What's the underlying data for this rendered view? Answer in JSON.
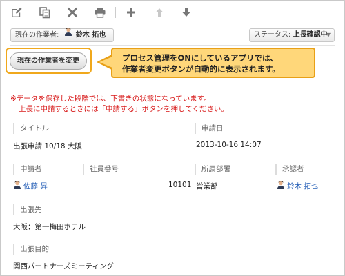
{
  "toolbar": {
    "icons": [
      "edit-icon",
      "copy-icon",
      "delete-icon",
      "print-icon",
      "add-icon",
      "up-arrow-icon",
      "down-arrow-icon"
    ]
  },
  "assignee": {
    "label": "現在の作業者:",
    "name": "鈴木 拓也"
  },
  "status": {
    "label": "ステータス:",
    "value": "上長確認中"
  },
  "change_button": {
    "label": "現在の作業者を変更"
  },
  "callout": {
    "line1": "プロセス管理をONにしているアプリでは、",
    "line2": "作業者変更ボタンが自動的に表示されます。"
  },
  "notice": {
    "line1": "※データを保存した段階では、下書きの状態になっています。",
    "line2": "上長に申請するときには「申請する」ボタンを押してください。"
  },
  "fields": {
    "title": {
      "label": "タイトル",
      "value": "出張申請 10/18 大阪"
    },
    "date": {
      "label": "申請日",
      "value": "2013-10-16 14:07"
    },
    "applicant": {
      "label": "申請者",
      "value": "佐藤 昇"
    },
    "employee_no": {
      "label": "社員番号",
      "value": "10101"
    },
    "department": {
      "label": "所属部署",
      "value": "営業部"
    },
    "approver": {
      "label": "承認者",
      "value": "鈴木 拓也"
    },
    "destination": {
      "label": "出張先",
      "value": "大阪：第一梅田ホテル"
    },
    "purpose": {
      "label": "出張目的",
      "value": "関西パートナーズミーティング"
    }
  },
  "colors": {
    "highlight": "#f0a81c",
    "callout_bg": "#ffd77a",
    "notice": "#d81b1b",
    "link": "#2a62b8"
  }
}
